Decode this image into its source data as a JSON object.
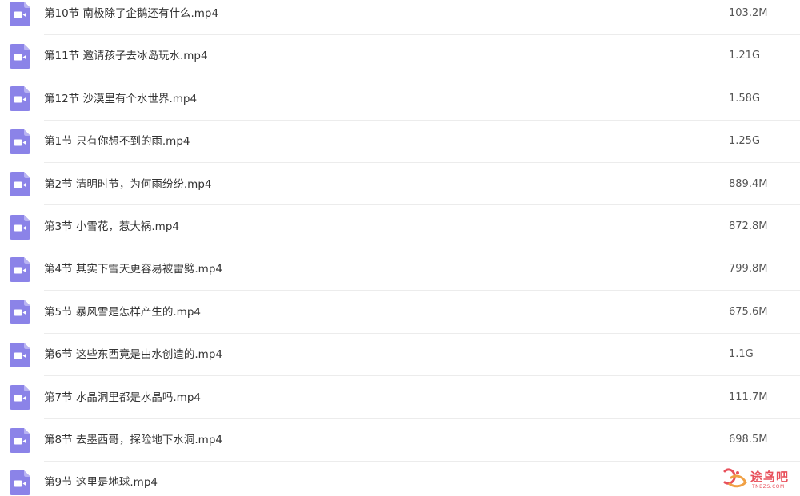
{
  "files": [
    {
      "name": "第10节 南极除了企鹅还有什么.mp4",
      "size": "103.2M",
      "icon": "video-file-icon"
    },
    {
      "name": "第11节 邀请孩子去冰岛玩水.mp4",
      "size": "1.21G",
      "icon": "video-file-icon"
    },
    {
      "name": "第12节 沙漠里有个水世界.mp4",
      "size": "1.58G",
      "icon": "video-file-icon"
    },
    {
      "name": "第1节 只有你想不到的雨.mp4",
      "size": "1.25G",
      "icon": "video-file-icon"
    },
    {
      "name": "第2节 清明时节，为何雨纷纷.mp4",
      "size": "889.4M",
      "icon": "video-file-icon"
    },
    {
      "name": "第3节 小雪花，惹大祸.mp4",
      "size": "872.8M",
      "icon": "video-file-icon"
    },
    {
      "name": "第4节 其实下雪天更容易被雷劈.mp4",
      "size": "799.8M",
      "icon": "video-file-icon"
    },
    {
      "name": "第5节 暴风雪是怎样产生的.mp4",
      "size": "675.6M",
      "icon": "video-file-icon"
    },
    {
      "name": "第6节 这些东西竟是由水创造的.mp4",
      "size": "1.1G",
      "icon": "video-file-icon"
    },
    {
      "name": "第7节 水晶洞里都是水晶吗.mp4",
      "size": "111.7M",
      "icon": "video-file-icon"
    },
    {
      "name": "第8节 去墨西哥，探险地下水洞.mp4",
      "size": "698.5M",
      "icon": "video-file-icon"
    },
    {
      "name": "第9节 这里是地球.mp4",
      "size": "",
      "icon": "video-file-icon"
    }
  ],
  "watermark": {
    "text": "途鸟吧",
    "subtext": "TNBZS.COM"
  },
  "colors": {
    "icon_fill": "#8b83e8",
    "icon_fold": "#b9b4f2",
    "text": "#333333",
    "watermark": "#e8505b"
  }
}
